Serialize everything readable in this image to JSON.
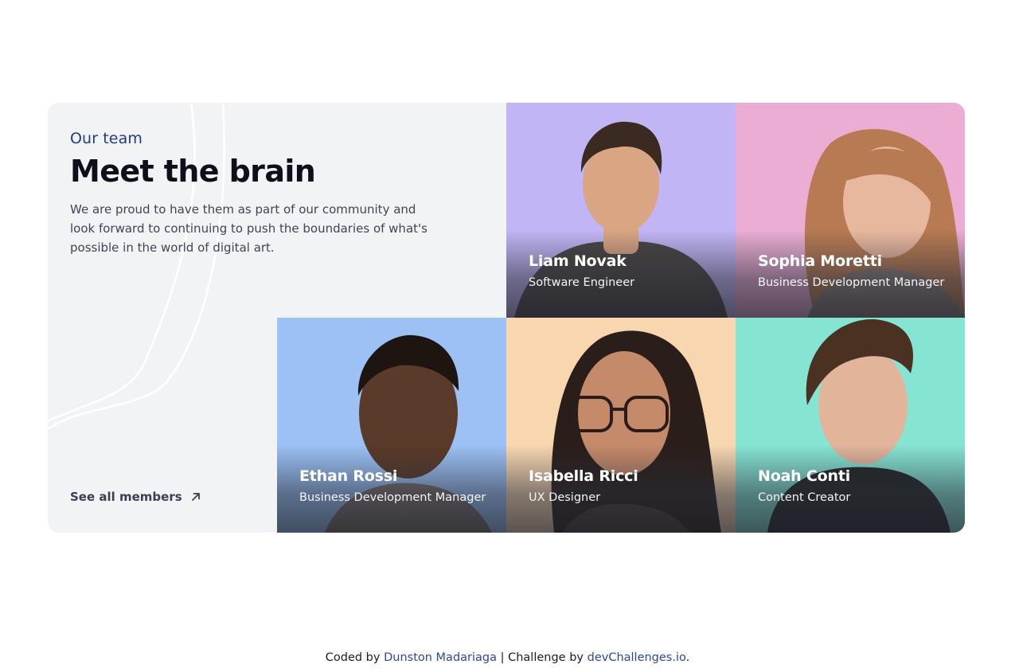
{
  "section": {
    "eyebrow": "Our team",
    "title": "Meet the brain",
    "description": "We are proud to have them as part of our community and look forward to continuing to push the boundaries of what's possible in the world of digital art.",
    "see_all_label": "See all members",
    "see_all_icon": "arrow-up-right-icon"
  },
  "members": [
    {
      "name": "Liam Novak",
      "role": "Software Engineer",
      "bg": "#c1b5f5",
      "skin": "#d9a583",
      "hair": "#3a2a20",
      "shirt": "#4a4442"
    },
    {
      "name": "Sophia Moretti",
      "role": "Business Development Manager",
      "bg": "#ecadd4",
      "skin": "#e8b89e",
      "hair": "#b77a52",
      "shirt": "#8a7b72"
    },
    {
      "name": "Ethan Rossi",
      "role": "Business Development Manager",
      "bg": "#9bc1f5",
      "skin": "#5a3a28",
      "hair": "#1e1410",
      "shirt": "#7a6f6a"
    },
    {
      "name": "Isabella Ricci",
      "role": "UX Designer",
      "bg": "#f8d7b0",
      "skin": "#c48a6a",
      "hair": "#2a1e1a",
      "shirt": "#4a3a36"
    },
    {
      "name": "Noah Conti",
      "role": "Content Creator",
      "bg": "#86e4d3",
      "skin": "#e2b49a",
      "hair": "#4a3122",
      "shirt": "#222625"
    }
  ],
  "footer": {
    "coded_by": "Coded by",
    "author": "Dunston Madariaga",
    "separator": "| Challenge by",
    "challenge": "devChallenges.io",
    "end": "."
  }
}
